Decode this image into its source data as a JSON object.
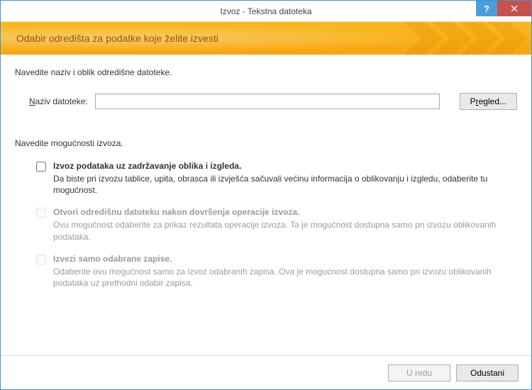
{
  "titlebar": {
    "title": "Izvoz - Tekstna datoteka",
    "help_symbol": "?"
  },
  "header": {
    "heading": "Odabir odredišta za podatke koje želite izvesti"
  },
  "content": {
    "instr1": "Navedite naziv i oblik odredišne datoteke.",
    "file_label_pre": "N",
    "file_label_post": "aziv datoteke:",
    "file_value": "",
    "browse_pre": "P",
    "browse_u": "r",
    "browse_post": "egled...",
    "instr2": "Navedite mogućnosti izvoza.",
    "options": [
      {
        "title": "Izvoz podataka uz zadržavanje oblika i izgleda.",
        "desc": "Da biste pri izvozu tablice, upita, obrasca ili izvješća sačuvali većinu informacija o oblikovanju i izgledu, odaberite tu mogućnost."
      },
      {
        "title": "Otvori odredišnu datoteku nakon dovršenja operacije izvoza.",
        "desc": "Ovu mogućnost odaberite za prikaz rezultata operacije izvoza. Ta je mogućnost dostupna samo pri izvozu oblikovanih podataka."
      },
      {
        "title": "Izvezi samo odabrane zapise.",
        "desc": "Odaberite ovu mogućnost samo za izvoz odabranih zapisa. Ova je mogućnost dostupna samo pri izvozu oblikovanih podataka uz prethodni odabir zapisa."
      }
    ]
  },
  "footer": {
    "ok": "U redu",
    "cancel": "Odustani"
  }
}
